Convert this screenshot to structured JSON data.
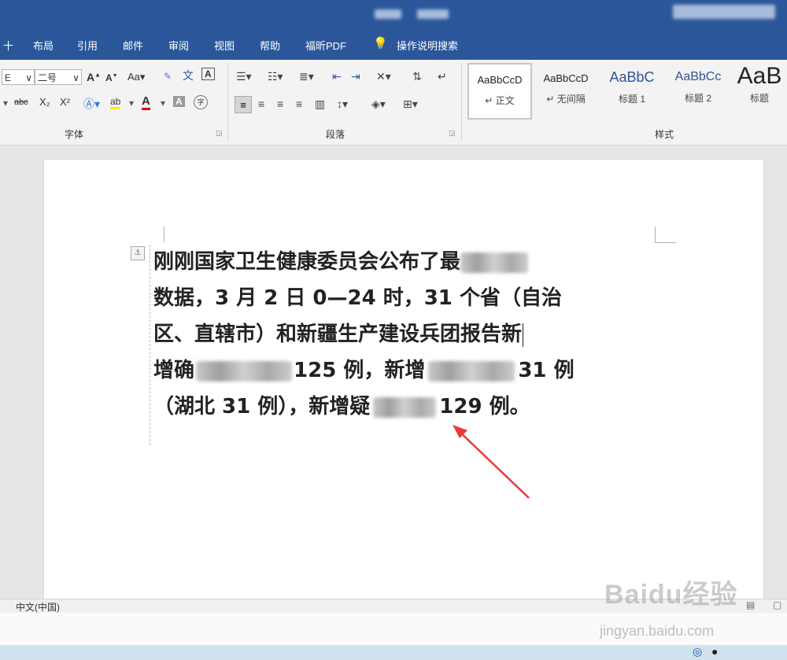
{
  "window": {
    "accent_color": "#2b579a"
  },
  "menu": {
    "tabs": [
      "十",
      "布局",
      "引用",
      "邮件",
      "审阅",
      "视图",
      "帮助",
      "福昕PDF"
    ],
    "tell_me_label": "操作说明搜索"
  },
  "ribbon": {
    "font": {
      "font_name_value": "E",
      "font_size_value": "二号",
      "group_label": "字体",
      "grow_font": "A",
      "shrink_font": "A",
      "change_case": "Aa",
      "strikethrough": "abc",
      "subscript": "X₂",
      "superscript": "X²",
      "highlight_label": "ab",
      "font_color_label": "A",
      "char_shading_label": "A",
      "phonetic_guide": "文",
      "char_border": "A",
      "enclose": "字"
    },
    "paragraph": {
      "group_label": "段落"
    },
    "styles": {
      "group_label": "样式",
      "items": [
        {
          "sample": "AaBbCcD",
          "name": "正文"
        },
        {
          "sample": "AaBbCcD",
          "name": "无间隔"
        },
        {
          "sample": "AaBbC",
          "name": "标题 1"
        },
        {
          "sample": "AaBbCc",
          "name": "标题 2"
        },
        {
          "sample": "AaB",
          "name": "标题"
        }
      ]
    }
  },
  "document": {
    "paragraph_lines": [
      [
        "刚刚国家卫生健康委员会公布了最"
      ],
      [
        "数据，3 月 2 日 0—24 时，31 个省（自治"
      ],
      [
        "区、直辖市）和新疆生产建设兵团报告新"
      ],
      [
        "增确",
        "125 例，新增",
        "31 例"
      ],
      [
        "（湖北 31 例），新增疑",
        "129 例。"
      ]
    ],
    "annotation_arrow_color": "#e83a3a"
  },
  "statusbar": {
    "language": "中文(中国)"
  },
  "watermark": {
    "logo": "Baidu经验",
    "url": "jingyan.baidu.com"
  }
}
